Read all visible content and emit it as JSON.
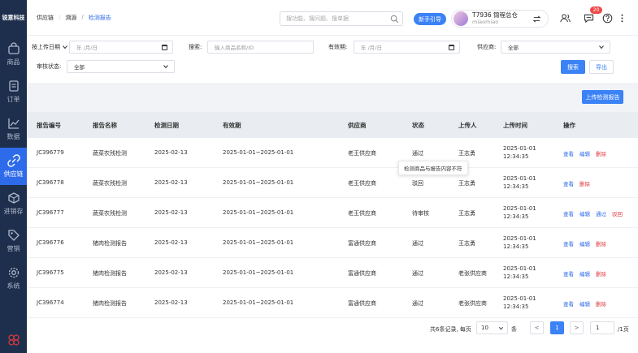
{
  "sidebar": {
    "logo": "锐意科技",
    "items": [
      {
        "label": "商品",
        "icon": "bag-icon"
      },
      {
        "label": "订单",
        "icon": "order-icon"
      },
      {
        "label": "数据",
        "icon": "chart-icon"
      },
      {
        "label": "供应链",
        "icon": "supply-chain-icon",
        "active": true
      },
      {
        "label": "进销存",
        "icon": "inventory-icon"
      },
      {
        "label": "营销",
        "icon": "tag-icon"
      },
      {
        "label": "系统",
        "icon": "gear-icon"
      }
    ]
  },
  "header": {
    "breadcrumb": [
      "供应链",
      "溯源",
      "检测报告"
    ],
    "search_placeholder": "搜功能、搜问题、搜单据",
    "guide_label": "新手引导",
    "user_name": "T7936 锦程总仓",
    "user_sub": "miaomiao",
    "badge_count": "20"
  },
  "filters": {
    "upload_date_label": "按上传日期",
    "date_placeholder": "年 /月/日",
    "search_label": "搜索:",
    "search_placeholder": "输入商品名称/ID",
    "validity_label": "有效期:",
    "supplier_label": "供应商:",
    "supplier_value": "全部",
    "audit_label": "审核状态:",
    "audit_value": "全部",
    "search_btn": "搜索",
    "export_btn": "导出"
  },
  "upload_btn": "上传检测报告",
  "table": {
    "headers": [
      "报告编号",
      "报告名称",
      "检测日期",
      "有效期",
      "供应商",
      "状态",
      "上传人",
      "上传时间",
      "操作"
    ],
    "rows": [
      {
        "id": "JC396779",
        "name": "蔬菜农残检测",
        "date": "2025-02-13",
        "validity": "2025-01-01~2025-01-01",
        "supplier": "老王供应商",
        "status": "通过",
        "uploader": "王志勇",
        "time1": "2025-01-01",
        "time2": "12:34:35",
        "ops": [
          {
            "t": "查看",
            "c": "blue"
          },
          {
            "t": "编辑",
            "c": "blue"
          },
          {
            "t": "删除",
            "c": "red"
          }
        ]
      },
      {
        "id": "JC396778",
        "name": "蔬菜农残检测",
        "date": "2025-02-13",
        "validity": "2025-01-01~2025-01-01",
        "supplier": "老王供应商",
        "status": "驳回",
        "uploader": "王志勇",
        "time1": "2025-01-01",
        "time2": "12:34:35",
        "ops": [
          {
            "t": "查看",
            "c": "blue"
          },
          {
            "t": "删除",
            "c": "red"
          }
        ]
      },
      {
        "id": "JC396777",
        "name": "蔬菜农残检测",
        "date": "2025-02-13",
        "validity": "2025-01-01~2025-01-01",
        "supplier": "老王供应商",
        "status": "待审核",
        "uploader": "王志勇",
        "time1": "2025-01-01",
        "time2": "12:34:35",
        "ops": [
          {
            "t": "查看",
            "c": "blue"
          },
          {
            "t": "编辑",
            "c": "blue"
          },
          {
            "t": "通过",
            "c": "blue"
          },
          {
            "t": "驳回",
            "c": "red"
          }
        ]
      },
      {
        "id": "JC396776",
        "name": "猪肉检测报告",
        "date": "2025-02-13",
        "validity": "2025-01-01~2025-01-01",
        "supplier": "富通供应商",
        "status": "通过",
        "uploader": "王志勇",
        "time1": "2025-01-01",
        "time2": "12:34:35",
        "ops": [
          {
            "t": "查看",
            "c": "blue"
          },
          {
            "t": "编辑",
            "c": "blue"
          },
          {
            "t": "删除",
            "c": "red"
          }
        ]
      },
      {
        "id": "JC396775",
        "name": "猪肉检测报告",
        "date": "2025-02-13",
        "validity": "2025-01-01~2025-01-01",
        "supplier": "富通供应商",
        "status": "通过",
        "uploader": "老张供应商",
        "time1": "2025-01-01",
        "time2": "12:34:35",
        "ops": [
          {
            "t": "查看",
            "c": "blue"
          },
          {
            "t": "编辑",
            "c": "blue"
          },
          {
            "t": "删除",
            "c": "red"
          }
        ]
      },
      {
        "id": "JC396774",
        "name": "猪肉检测报告",
        "date": "2025-02-13",
        "validity": "2025-01-01~2025-01-01",
        "supplier": "富通供应商",
        "status": "通过",
        "uploader": "老张供应商",
        "time1": "2025-01-01",
        "time2": "12:34:35",
        "ops": [
          {
            "t": "查看",
            "c": "blue"
          },
          {
            "t": "编辑",
            "c": "blue"
          },
          {
            "t": "删除",
            "c": "red"
          }
        ]
      }
    ]
  },
  "tooltip": "检测商品与报告内容不符",
  "pagination": {
    "summary": "共6条记录, 每页",
    "page_size": "10",
    "unit": "条",
    "prev": "<",
    "current": "1",
    "next": ">",
    "goto_value": "1",
    "total_pages": "/1页"
  }
}
